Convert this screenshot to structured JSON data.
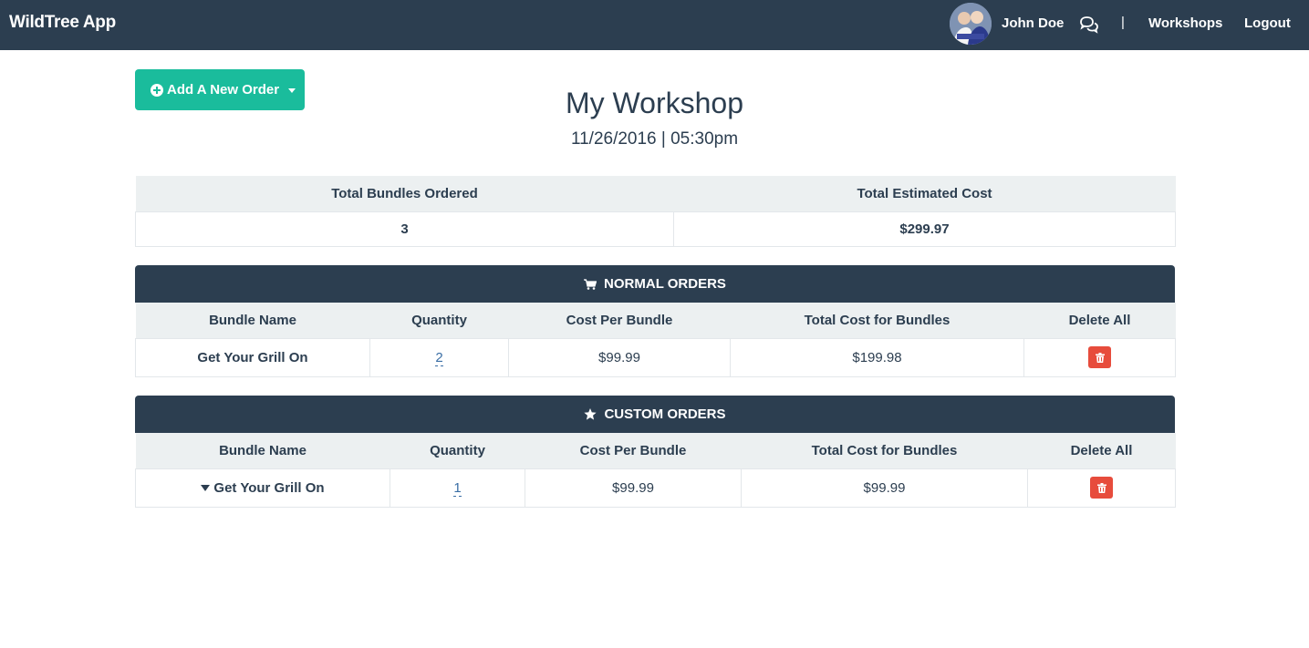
{
  "navbar": {
    "brand": "WildTree App",
    "user_name": "John Doe",
    "separator": "|",
    "workshops": "Workshops",
    "logout": "Logout"
  },
  "add_order": {
    "label": "Add A New Order"
  },
  "page": {
    "title": "My Workshop",
    "subtitle": "11/26/2016 | 05:30pm"
  },
  "summary": {
    "headers": [
      "Total Bundles Ordered",
      "Total Estimated Cost"
    ],
    "values": [
      "3",
      "$299.97"
    ]
  },
  "normal_orders": {
    "title": "NORMAL ORDERS",
    "headers": [
      "Bundle Name",
      "Quantity",
      "Cost Per Bundle",
      "Total Cost for Bundles",
      "Delete All"
    ],
    "rows": [
      {
        "name": "Get Your Grill On",
        "quantity": "2",
        "cost": "$99.99",
        "total": "$199.98"
      }
    ]
  },
  "custom_orders": {
    "title": "CUSTOM ORDERS",
    "headers": [
      "Bundle Name",
      "Quantity",
      "Cost Per Bundle",
      "Total Cost for Bundles",
      "Delete All"
    ],
    "rows": [
      {
        "name": "Get Your Grill On",
        "quantity": "1",
        "cost": "$99.99",
        "total": "$99.99"
      }
    ]
  },
  "colors": {
    "navbar": "#2c3e50",
    "accent": "#1abc9c",
    "danger": "#e74c3c",
    "header_bg": "#ecf0f1"
  }
}
